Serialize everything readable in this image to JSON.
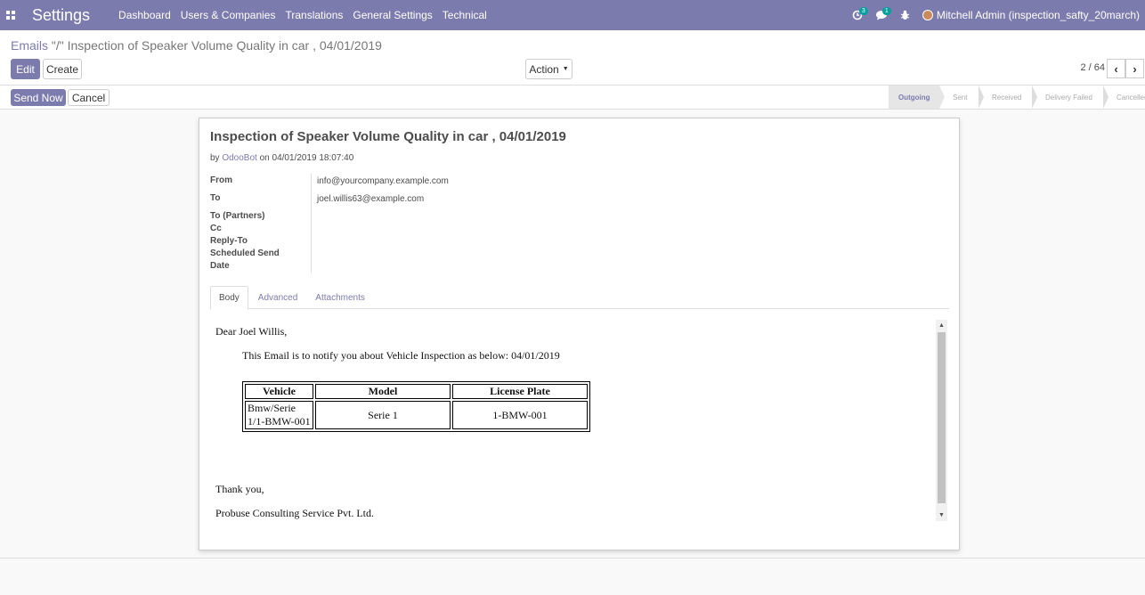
{
  "navbar": {
    "app_title": "Settings",
    "menu": [
      "Dashboard",
      "Users & Companies",
      "Translations",
      "General Settings",
      "Technical"
    ],
    "activities_badge": "3",
    "messages_badge": "1",
    "user_label": "Mitchell Admin (inspection_safty_20march)",
    "icons": [
      "apps-icon",
      "activity-clock-icon",
      "chat-icon",
      "bug-icon"
    ],
    "bg_color": "#7c7bad"
  },
  "breadcrumb": {
    "parent": "Emails",
    "separator": " \"/\" ",
    "current": "Inspection of Speaker Volume Quality in car , 04/01/2019"
  },
  "toolbar": {
    "edit_label": "Edit",
    "create_label": "Create",
    "action_label": "Action",
    "pager_value": "2 / 64"
  },
  "statusbar": {
    "send_now_label": "Send Now",
    "cancel_label": "Cancel",
    "stages": [
      "Outgoing",
      "Sent",
      "Received",
      "Delivery Failed",
      "Cancelled"
    ],
    "active_stage": "Outgoing"
  },
  "mail": {
    "subject": "Inspection of Speaker Volume Quality in car , 04/01/2019",
    "by_prefix": "by",
    "author": "OdooBot",
    "date_text": "on 04/01/2019 18:07:40",
    "fields": {
      "from_label": "From",
      "from_value": "info@yourcompany.example.com",
      "to_label": "To",
      "to_value": "joel.willis63@example.com",
      "to_partners_label": "To (Partners)",
      "cc_label": "Cc",
      "reply_to_label": "Reply-To",
      "scheduled_label": "Scheduled Send",
      "date_label": "Date"
    },
    "tabs": [
      "Body",
      "Advanced",
      "Attachments"
    ],
    "active_tab": "Body"
  },
  "body": {
    "greeting": "Dear Joel Willis,",
    "intro": "This Email is to notify you about Vehicle Inspection as below: 04/01/2019",
    "table_headers": [
      "Vehicle",
      "Model",
      "License Plate"
    ],
    "table_rows": [
      [
        "Bmw/Serie 1/1-BMW-001",
        "Serie 1",
        "1-BMW-001"
      ]
    ],
    "vehicle_line1": "Bmw/Serie",
    "vehicle_line2": "1/1-BMW-001",
    "thanks": "Thank you,",
    "company": "Probuse Consulting Service Pvt. Ltd."
  }
}
